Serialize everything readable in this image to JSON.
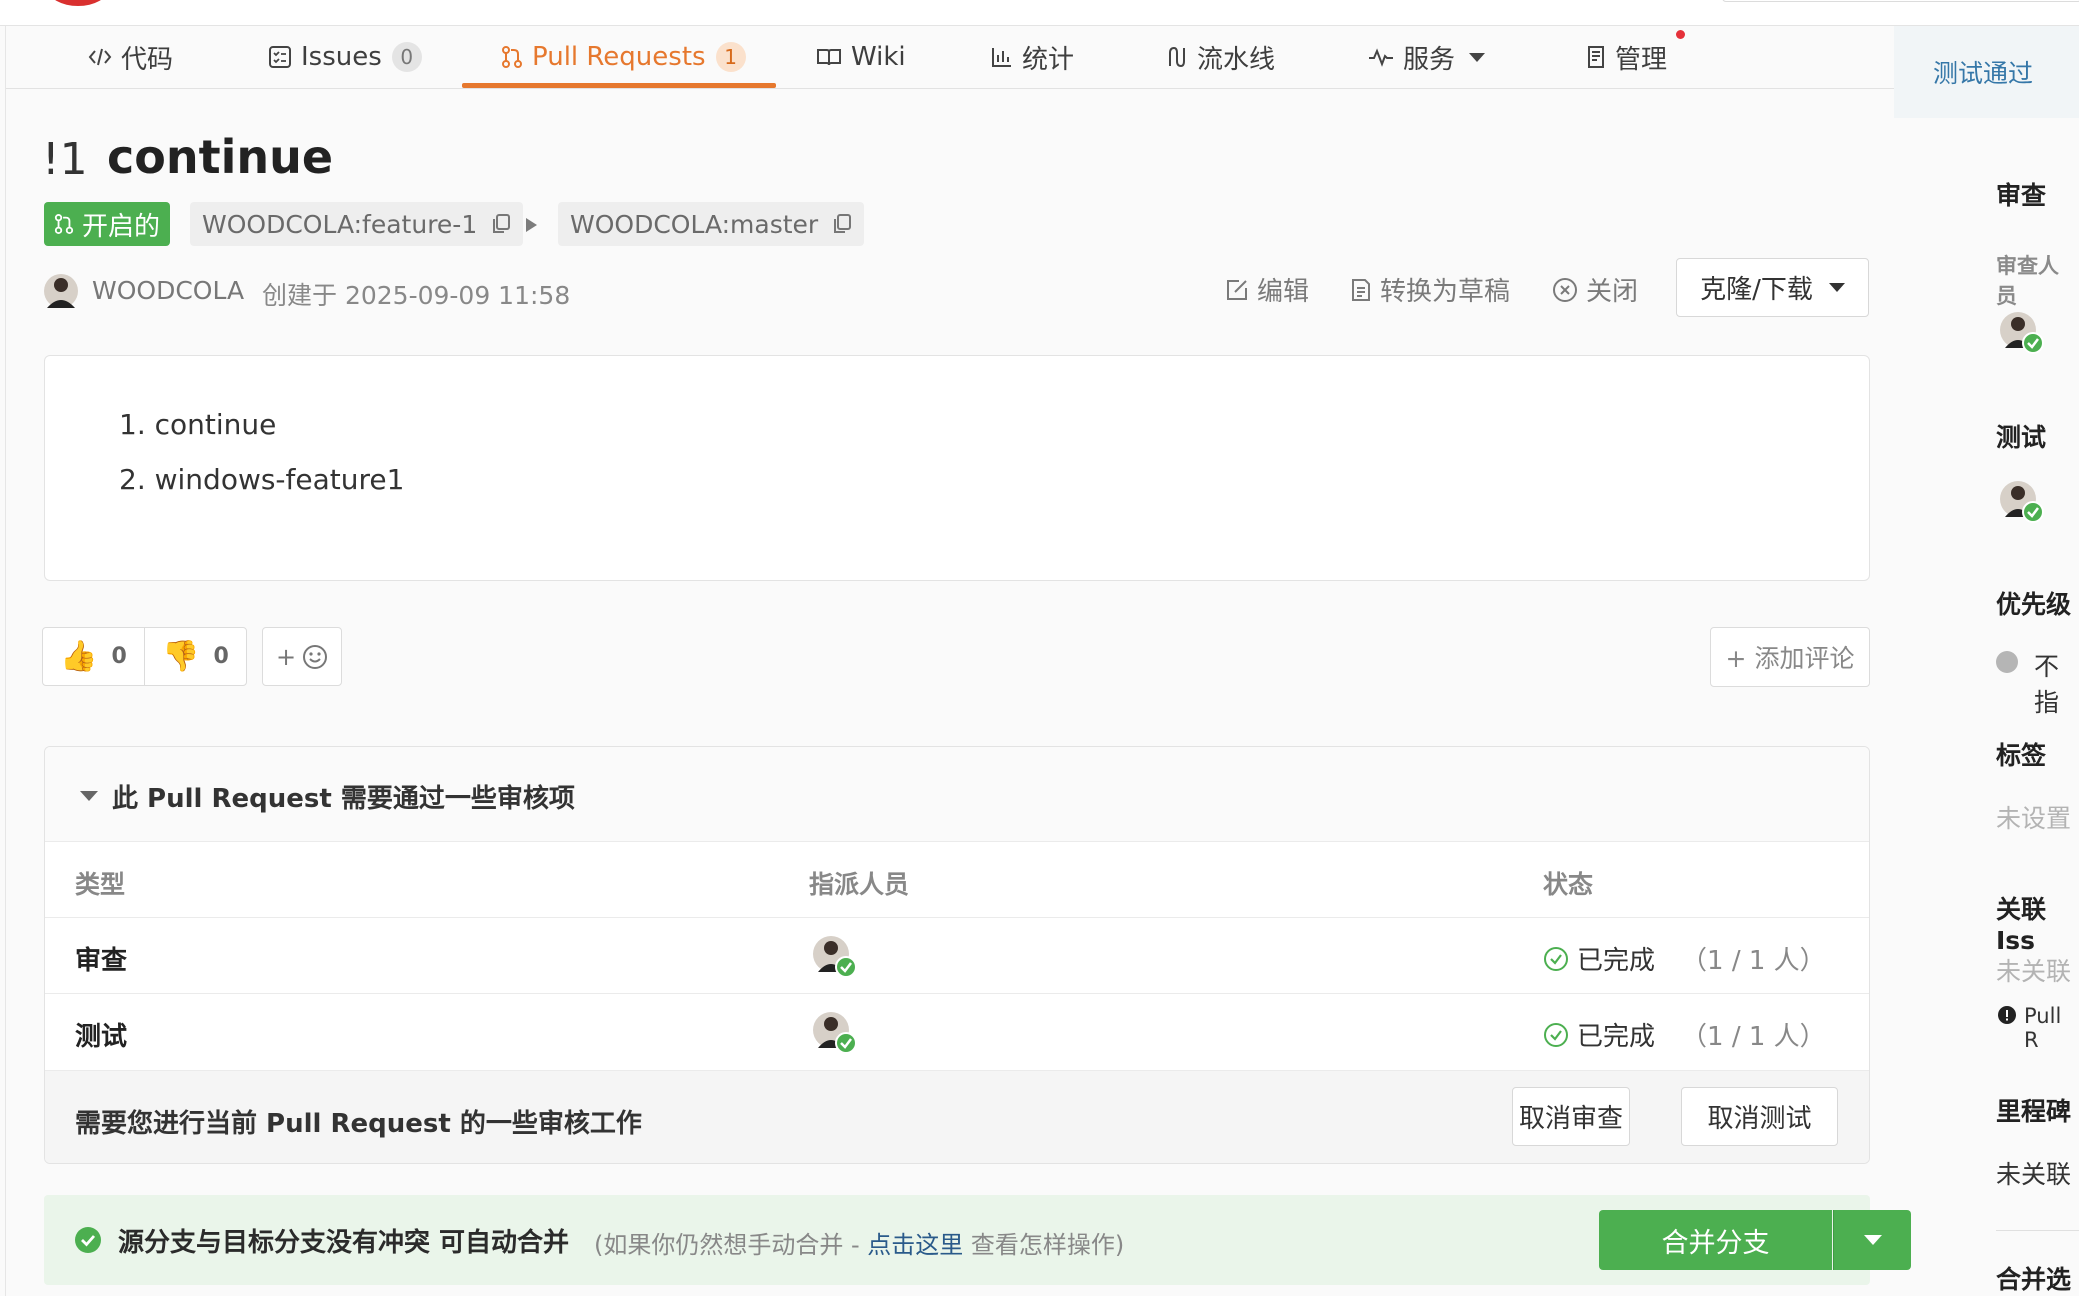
{
  "nav": {
    "tabs": [
      {
        "label": "代码",
        "icon": "code-icon"
      },
      {
        "label": "Issues",
        "icon": "issues-icon",
        "count": "0"
      },
      {
        "label": "Pull Requests",
        "icon": "pull-request-icon",
        "count": "1",
        "active": true
      },
      {
        "label": "Wiki",
        "icon": "book-icon"
      },
      {
        "label": "统计",
        "icon": "bar-chart-icon"
      },
      {
        "label": "流水线",
        "icon": "pipeline-icon"
      },
      {
        "label": "服务",
        "icon": "pulse-icon"
      },
      {
        "label": "管理",
        "icon": "document-icon"
      }
    ]
  },
  "sidebar": {
    "status_tag": "测试通过",
    "review": {
      "heading": "审查",
      "sub": "审查人员"
    },
    "test": {
      "heading": "测试"
    },
    "priority": {
      "heading": "优先级",
      "value": "不指"
    },
    "labels": {
      "heading": "标签",
      "value": "未设置"
    },
    "issues": {
      "heading": "关联 Iss",
      "value": "未关联",
      "note": "Pull R"
    },
    "milestone": {
      "heading": "里程碑",
      "value": "未关联"
    },
    "merge_options": {
      "heading": "合并选"
    }
  },
  "pr": {
    "number": "!1",
    "title": "continue",
    "status": "开启的",
    "source_branch": "WOODCOLA:feature-1",
    "target_branch": "WOODCOLA:master",
    "author": "WOODCOLA",
    "created": "创建于 2025-09-09 11:58",
    "actions": {
      "edit": "编辑",
      "draft": "转换为草稿",
      "close": "关闭",
      "clone": "克隆/下载"
    },
    "description": [
      "1. continue",
      "2. windows-feature1"
    ]
  },
  "reactions": {
    "thumbs_up": "0",
    "thumbs_down": "0",
    "emoji_plus": "+",
    "add_comment": "+ 添加评论"
  },
  "review_box": {
    "title": "此 Pull Request 需要通过一些审核项",
    "columns": [
      "类型",
      "指派人员",
      "状态"
    ],
    "rows": [
      {
        "type": "审查",
        "status": "已完成",
        "count": "（1 / 1 人）"
      },
      {
        "type": "测试",
        "status": "已完成",
        "count": "（1 / 1 人）"
      }
    ],
    "footer_text": "需要您进行当前 Pull Request 的一些审核工作",
    "cancel_review": "取消审查",
    "cancel_test": "取消测试"
  },
  "merge": {
    "message": "源分支与目标分支没有冲突 可自动合并",
    "hint_prefix": "(如果你仍然想手动合并 - ",
    "hint_link": "点击这里",
    "hint_suffix": " 查看怎样操作)",
    "button": "合并分支"
  },
  "colors": {
    "accent": "#e6782e",
    "success": "#4caf50",
    "link": "#3577a8"
  }
}
